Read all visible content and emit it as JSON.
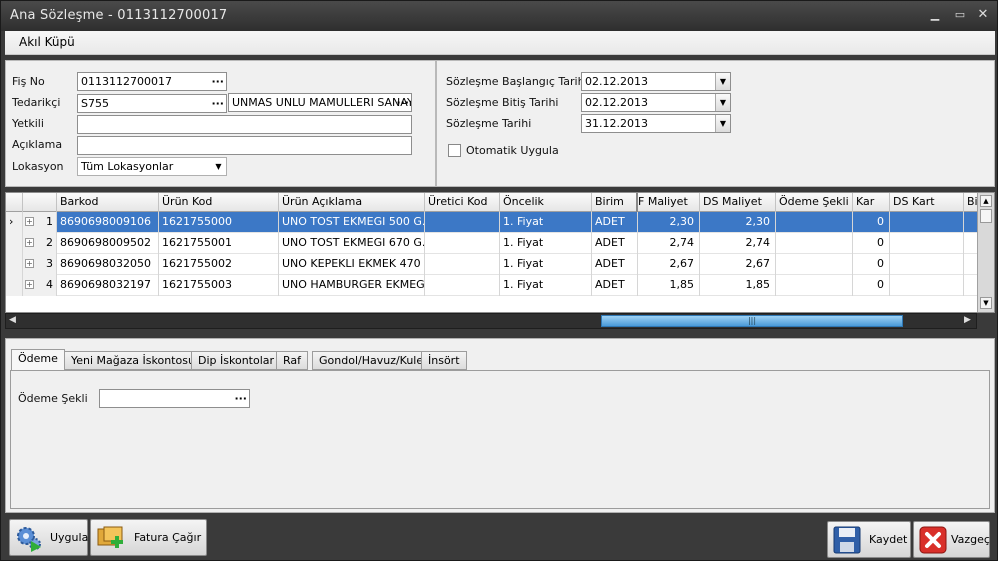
{
  "window": {
    "title": "Ana Sözleşme - 0113112700017"
  },
  "menu": {
    "items": [
      "Akıl Küpü"
    ]
  },
  "form": {
    "fis_no_label": "Fiş No",
    "fis_no_value": "0113112700017",
    "tedarikci_label": "Tedarikçi",
    "tedarikci_code": "S755",
    "tedarikci_name": "UNMAS UNLU MAMULLERI SANAY",
    "yetkili_label": "Yetkili",
    "yetkili_value": "",
    "aciklama_label": "Açıklama",
    "aciklama_value": "",
    "lokasyon_label": "Lokasyon",
    "lokasyon_value": "Tüm Lokasyonlar"
  },
  "dates": {
    "baslangic_label": "Sözleşme Başlangıç Tarihi",
    "baslangic_value": "02.12.2013",
    "bitis_label": "Sözleşme Bitiş Tarihi",
    "bitis_value": "02.12.2013",
    "tarih_label": "Sözleşme Tarihi",
    "tarih_value": "31.12.2013",
    "otomatik_label": "Otomatik Uygula",
    "otomatik_checked": false
  },
  "grid": {
    "columns": [
      "Barkod",
      "Ürün Kod",
      "Ürün Açıklama",
      "Üretici Kod",
      "Öncelik",
      "Birim",
      "F Maliyet",
      "DS Maliyet",
      "Ödeme Şekli",
      "Kar",
      "DS Kart",
      "Bi"
    ],
    "rows": [
      {
        "no": "1",
        "barkod": "8690698009106",
        "urun_kod": "1621755000",
        "aciklama": "UNO TOST EKMEGI 500 G...",
        "uretici": "",
        "oncelik": "1. Fiyat",
        "birim": "ADET",
        "f_maliyet": "2,30",
        "ds_maliyet": "2,30",
        "odeme": "",
        "kar": "0",
        "ds_kart": ""
      },
      {
        "no": "2",
        "barkod": "8690698009502",
        "urun_kod": "1621755001",
        "aciklama": "UNO TOST EKMEGI 670 G...",
        "uretici": "",
        "oncelik": "1. Fiyat",
        "birim": "ADET",
        "f_maliyet": "2,74",
        "ds_maliyet": "2,74",
        "odeme": "",
        "kar": "0",
        "ds_kart": ""
      },
      {
        "no": "3",
        "barkod": "8690698032050",
        "urun_kod": "1621755002",
        "aciklama": "UNO KEPEKLI EKMEK 470 ...",
        "uretici": "",
        "oncelik": "1. Fiyat",
        "birim": "ADET",
        "f_maliyet": "2,67",
        "ds_maliyet": "2,67",
        "odeme": "",
        "kar": "0",
        "ds_kart": ""
      },
      {
        "no": "4",
        "barkod": "8690698032197",
        "urun_kod": "1621755003",
        "aciklama": "UNO HAMBURGER EKMEGI ...",
        "uretici": "",
        "oncelik": "1. Fiyat",
        "birim": "ADET",
        "f_maliyet": "1,85",
        "ds_maliyet": "1,85",
        "odeme": "",
        "kar": "0",
        "ds_kart": ""
      }
    ]
  },
  "tabs": [
    "Ödeme",
    "Yeni Mağaza İskontosu",
    "Dip İskontolar",
    "Raf",
    "Gondol/Havuz/Kule",
    "İnsört"
  ],
  "odeme": {
    "label": "Ödeme Şekli",
    "value": ""
  },
  "buttons": {
    "uygula": "Uygula",
    "fatura": "Fatura Çağır",
    "kaydet": "Kaydet",
    "vazgec": "Vazgeç"
  }
}
